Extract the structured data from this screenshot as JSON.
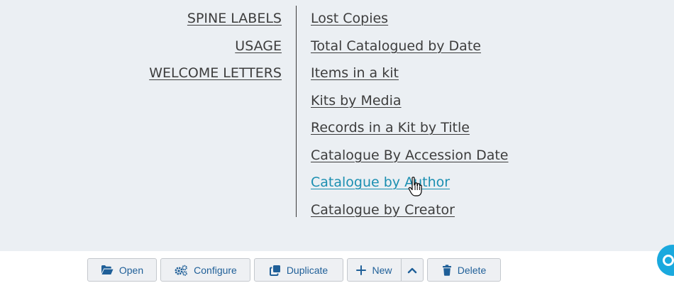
{
  "reports": {
    "left_links": [
      "SPINE LABELS",
      "USAGE",
      "WELCOME LETTERS"
    ],
    "right_links": [
      "Lost Copies",
      "Total Catalogued by Date",
      "Items in a kit",
      "Kits by Media",
      "Records in a Kit by Title",
      "Catalogue By Accession Date",
      "Catalogue by Author",
      "Catalogue by Creator"
    ],
    "hovered_link": "Catalogue by Author"
  },
  "toolbar": {
    "open_label": "Open",
    "configure_label": "Configure",
    "duplicate_label": "Duplicate",
    "new_label": "New",
    "delete_label": "Delete"
  },
  "colors": {
    "link": "#3d3d3d",
    "link_hover": "#1b8fb1",
    "button_text": "#1f5f98",
    "help_button": "#1aa9de"
  },
  "icons": {
    "open": "folder-open-icon",
    "configure": "gears-icon",
    "duplicate": "copy-icon",
    "new": "plus-icon",
    "new_toggle": "chevron-up-icon",
    "delete": "trash-icon",
    "help": "help-icon",
    "cursor": "hand-pointer-icon"
  }
}
